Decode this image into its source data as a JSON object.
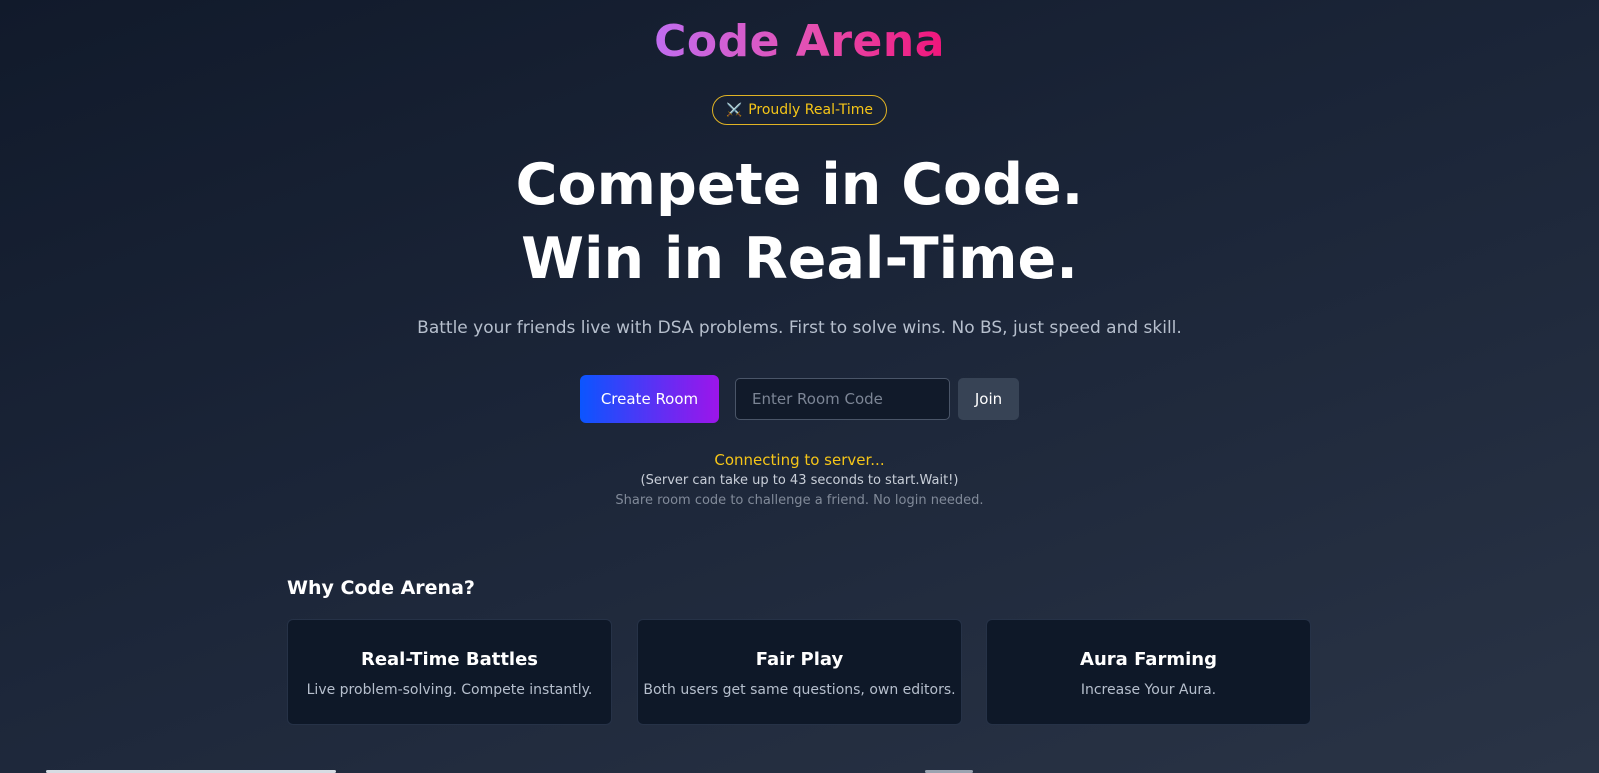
{
  "brand": {
    "logo_text": "Code Arena",
    "gradient_colors": [
      "#c06df0",
      "#e54fb0",
      "#f0157a"
    ]
  },
  "badge": {
    "icon": "crossed-swords-icon",
    "icon_glyph": "⚔️",
    "label": "Proudly Real-Time",
    "color": "#f5c518"
  },
  "hero": {
    "headline_line1": "Compete in Code.",
    "headline_line2": "Win in Real-Time.",
    "subtitle": "Battle your friends live with DSA problems. First to solve wins. No BS, just speed and skill."
  },
  "actions": {
    "create_room_label": "Create Room",
    "room_code_placeholder": "Enter Room Code",
    "room_code_value": "",
    "join_label": "Join",
    "create_gradient": [
      "#0b55ff",
      "#9d15ea"
    ]
  },
  "status": {
    "connecting": "Connecting to server...",
    "wait_note": "(Server can take up to 43 seconds to start.Wait!)",
    "share_note": "Share room code to challenge a friend. No login needed.",
    "connecting_color": "#f5c518"
  },
  "features": {
    "title": "Why Code Arena?",
    "cards": [
      {
        "title": "Real-Time Battles",
        "description": "Live problem-solving. Compete instantly."
      },
      {
        "title": "Fair Play",
        "description": "Both users get same questions, own editors."
      },
      {
        "title": "Aura Farming",
        "description": "Increase Your Aura."
      }
    ]
  }
}
